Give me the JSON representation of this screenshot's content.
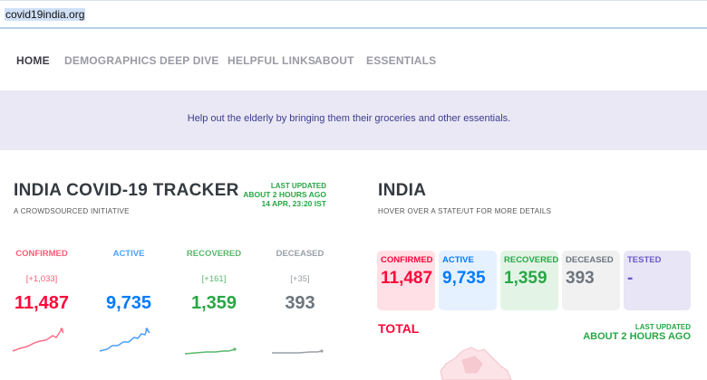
{
  "browser": {
    "url": "covid19india.org"
  },
  "nav": {
    "items": [
      {
        "label": "HOME",
        "active": true
      },
      {
        "label": "DEMOGRAPHICS",
        "active": false
      },
      {
        "label": "DEEP DIVE",
        "active": false
      },
      {
        "label": "HELPFUL LINKS",
        "active": false
      },
      {
        "label": "ABOUT",
        "active": false
      },
      {
        "label": "ESSENTIALS",
        "active": false
      }
    ]
  },
  "banner": {
    "text": "Help out the elderly by bringing them their groceries and other essentials."
  },
  "tracker": {
    "title": "INDIA COVID-19 TRACKER",
    "subtitle": "A CROWDSOURCED INITIATIVE",
    "last_updated": {
      "label": "LAST UPDATED",
      "relative": "ABOUT 2 HOURS AGO",
      "date": "14 APR, 23:20 IST"
    },
    "stats": {
      "confirmed": {
        "label": "CONFIRMED",
        "delta": "[+1,033]",
        "total": "11,487"
      },
      "active": {
        "label": "ACTIVE",
        "delta": "",
        "total": "9,735"
      },
      "recovered": {
        "label": "RECOVERED",
        "delta": "[+161]",
        "total": "1,359"
      },
      "deceased": {
        "label": "DECEASED",
        "delta": "[+35]",
        "total": "393"
      }
    }
  },
  "india_panel": {
    "title": "INDIA",
    "subtitle": "HOVER OVER A STATE/UT FOR MORE DETAILS",
    "cards": {
      "confirmed": {
        "label": "CONFIRMED",
        "value": "11,487"
      },
      "active": {
        "label": "ACTIVE",
        "value": "9,735"
      },
      "recovered": {
        "label": "RECOVERED",
        "value": "1,359"
      },
      "deceased": {
        "label": "DECEASED",
        "value": "393"
      },
      "tested": {
        "label": "TESTED",
        "value": "-"
      }
    },
    "total_label": "TOTAL",
    "last_updated": {
      "label": "LAST UPDATED",
      "relative": "ABOUT 2 HOURS AGO"
    }
  },
  "colors": {
    "confirmed": "#ff073a",
    "active": "#007bff",
    "recovered": "#28a745",
    "deceased": "#6c757d",
    "tested": "#6a58c6",
    "banner_bg": "#e9e8f4"
  }
}
